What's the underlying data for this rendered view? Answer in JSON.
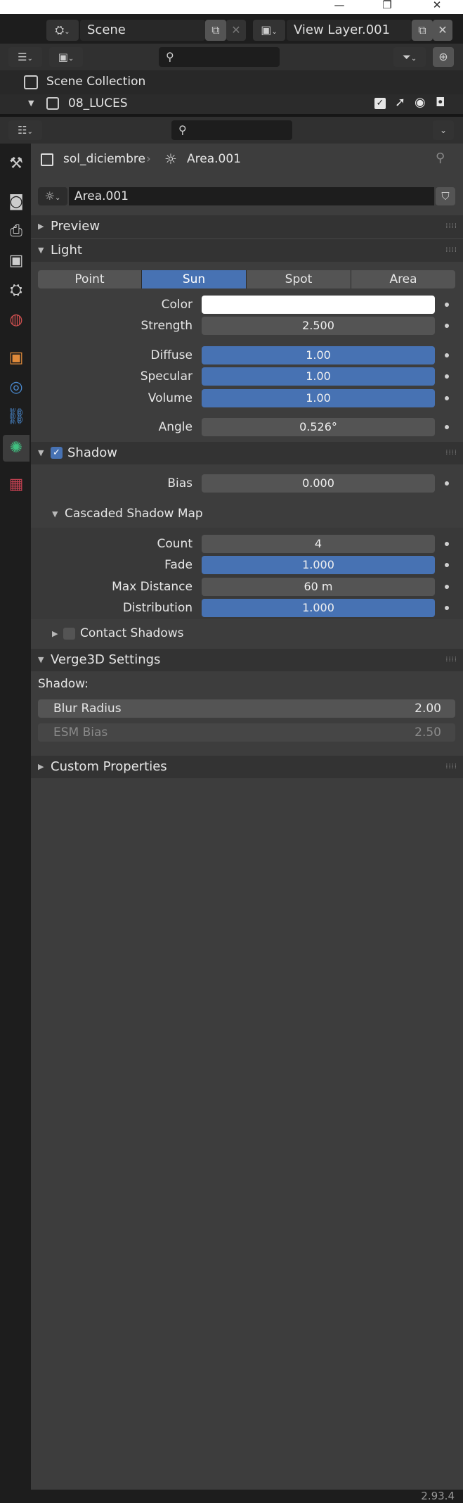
{
  "window": {
    "minimize": "—",
    "restore": "❐",
    "close": "✕"
  },
  "topbar": {
    "scene_name": "Scene",
    "view_layer_name": "View Layer.001"
  },
  "outliner": {
    "items": [
      {
        "label": "Scene Collection"
      },
      {
        "label": "08_LUCES"
      }
    ]
  },
  "breadcrumb": {
    "object": "sol_diciembre",
    "separator": "›",
    "data": "Area.001"
  },
  "datablock": {
    "name": "Area.001"
  },
  "panels": {
    "preview": "Preview",
    "light": "Light",
    "shadow": "Shadow",
    "cascaded": "Cascaded Shadow Map",
    "contact": "Contact Shadows",
    "verge": "Verge3D Settings",
    "custom": "Custom Properties"
  },
  "light": {
    "types": [
      "Point",
      "Sun",
      "Spot",
      "Area"
    ],
    "selected_type": "Sun",
    "color_label": "Color",
    "color_value": "#ffffff",
    "strength_label": "Strength",
    "strength": "2.500",
    "diffuse_label": "Diffuse",
    "diffuse": "1.00",
    "specular_label": "Specular",
    "specular": "1.00",
    "volume_label": "Volume",
    "volume": "1.00",
    "angle_label": "Angle",
    "angle": "0.526°"
  },
  "shadow": {
    "enabled": true,
    "bias_label": "Bias",
    "bias": "0.000"
  },
  "cascaded": {
    "count_label": "Count",
    "count": "4",
    "fade_label": "Fade",
    "fade": "1.000",
    "maxdist_label": "Max Distance",
    "maxdist": "60 m",
    "dist_label": "Distribution",
    "dist": "1.000"
  },
  "contact": {
    "enabled": false
  },
  "verge": {
    "shadow_label": "Shadow:",
    "blur_label": "Blur Radius",
    "blur": "2.00",
    "esm_label": "ESM Bias",
    "esm": "2.50"
  },
  "status": {
    "version": "2.93.4"
  },
  "colors": {
    "accent": "#4772b3",
    "background": "#3d3d3d",
    "header": "#303030"
  }
}
